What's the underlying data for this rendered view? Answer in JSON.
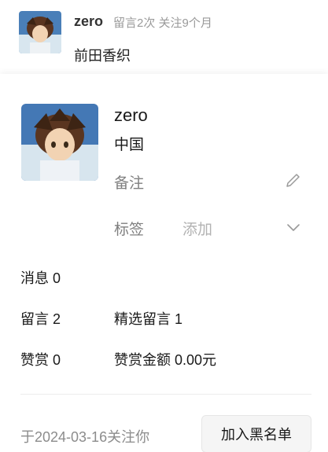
{
  "comment": {
    "author": "zero",
    "meta": "留言2次 关注9个月",
    "text": "前田香织"
  },
  "profile": {
    "name": "zero",
    "region": "中国",
    "remark_label": "备注",
    "tag_label": "标签",
    "tag_add": "添加",
    "stats": {
      "messages": "消息 0",
      "comments": "留言 2",
      "featured_comments": "精选留言 1",
      "rewards": "赞赏 0",
      "reward_amount": "赞赏金额 0.00元"
    },
    "followed_since": "于2024-03-16关注你",
    "block_button": "加入黑名单"
  },
  "icons": {
    "edit": "pencil-icon",
    "expand": "chevron-down-icon"
  },
  "colors": {
    "text": "#191919",
    "muted": "#7f7f7f",
    "placeholder": "#b2b2b2",
    "button_bg": "#f5f5f5"
  }
}
